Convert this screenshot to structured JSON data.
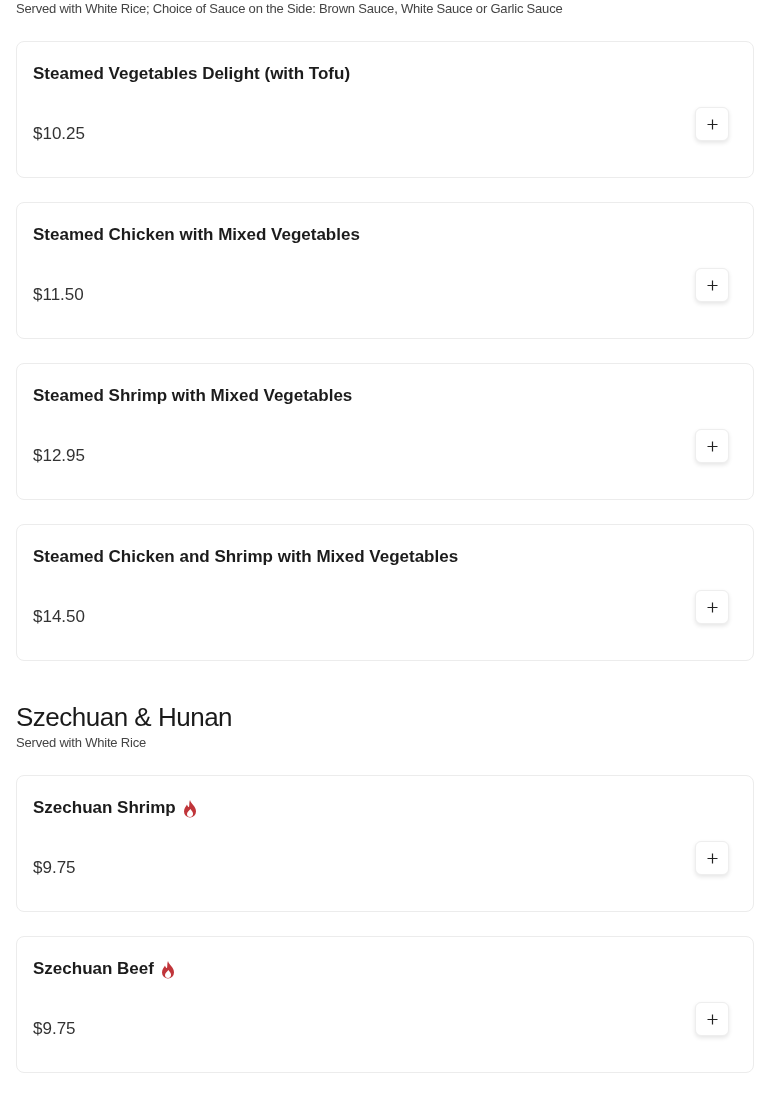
{
  "sections": [
    {
      "subtitle": "Served with White Rice; Choice of Sauce on the Side: Brown Sauce, White Sauce or Garlic Sauce",
      "items": [
        {
          "name": "Steamed Vegetables Delight (with Tofu)",
          "price": "$10.25",
          "spicy": false
        },
        {
          "name": "Steamed Chicken with Mixed Vegetables",
          "price": "$11.50",
          "spicy": false
        },
        {
          "name": "Steamed Shrimp with Mixed Vegetables",
          "price": "$12.95",
          "spicy": false
        },
        {
          "name": "Steamed Chicken and Shrimp with Mixed Vegetables",
          "price": "$14.50",
          "spicy": false
        }
      ]
    },
    {
      "title": "Szechuan & Hunan",
      "subtitle": "Served with White Rice",
      "items": [
        {
          "name": "Szechuan Shrimp",
          "price": "$9.75",
          "spicy": true
        },
        {
          "name": "Szechuan Beef",
          "price": "$9.75",
          "spicy": true
        }
      ]
    }
  ]
}
